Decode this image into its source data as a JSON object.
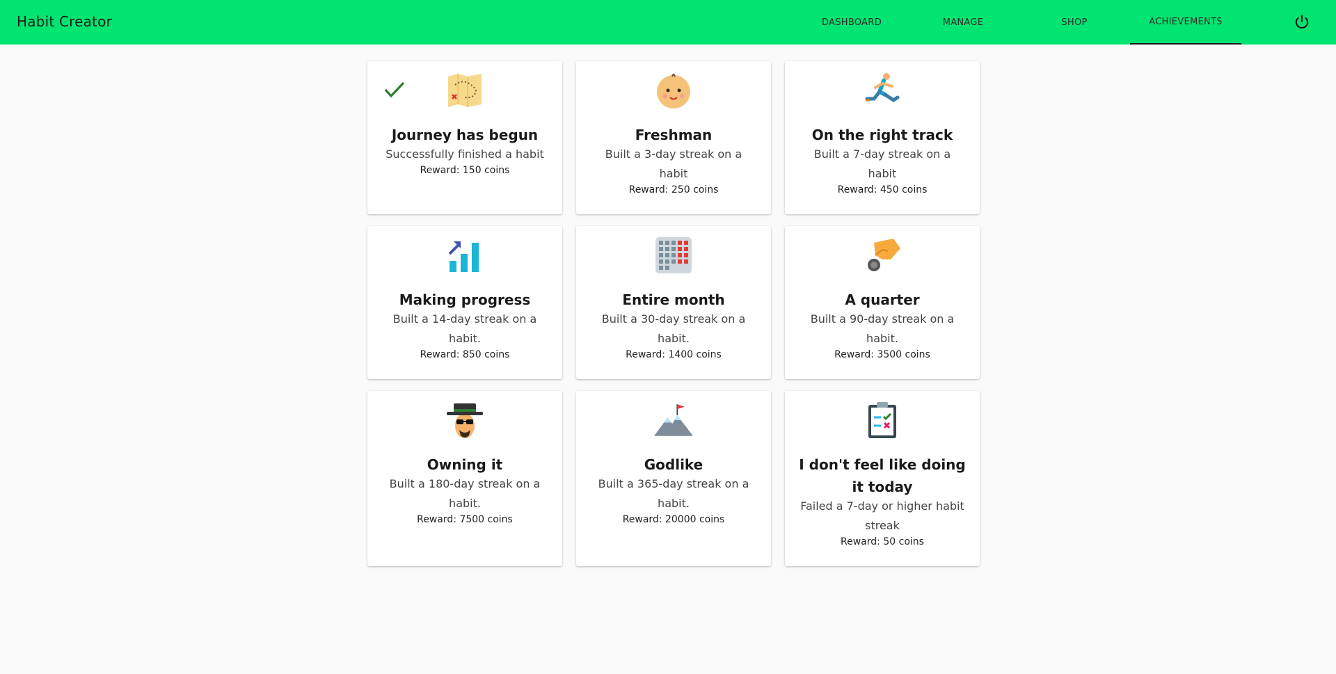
{
  "app": {
    "title": "Habit Creator"
  },
  "nav": {
    "tabs": [
      {
        "label": "DASHBOARD",
        "active": false
      },
      {
        "label": "MANAGE",
        "active": false
      },
      {
        "label": "SHOP",
        "active": false
      },
      {
        "label": "ACHIEVEMENTS",
        "active": true
      }
    ],
    "power_icon": "power-icon"
  },
  "colors": {
    "header": "#00e571",
    "background": "#fafafa",
    "check": "#2e7d32"
  },
  "achievements": [
    {
      "title": "Journey has begun",
      "description": "Successfully finished a habit",
      "reward": "Reward: 150 coins",
      "icon": "treasure-map-icon",
      "unlocked": true
    },
    {
      "title": "Freshman",
      "description": "Built a 3-day streak on a habit",
      "reward": "Reward: 250 coins",
      "icon": "baby-face-icon",
      "unlocked": false
    },
    {
      "title": "On the right track",
      "description": "Built a 7-day streak on a habit",
      "reward": "Reward: 450 coins",
      "icon": "runner-icon",
      "unlocked": false
    },
    {
      "title": "Making progress",
      "description": "Built a 14-day streak on a habit.",
      "reward": "Reward: 850 coins",
      "icon": "growth-chart-icon",
      "unlocked": false
    },
    {
      "title": "Entire month",
      "description": "Built a 30-day streak on a habit.",
      "reward": "Reward: 1400 coins",
      "icon": "calendar-grid-icon",
      "unlocked": false
    },
    {
      "title": "A quarter",
      "description": "Built a 90-day streak on a habit.",
      "reward": "Reward: 3500 coins",
      "icon": "hand-coin-icon",
      "unlocked": false
    },
    {
      "title": "Owning it",
      "description": "Built a 180-day streak on a habit.",
      "reward": "Reward: 7500 coins",
      "icon": "hat-sunglasses-man-icon",
      "unlocked": false
    },
    {
      "title": "Godlike",
      "description": "Built a 365-day streak on a habit.",
      "reward": "Reward: 20000 coins",
      "icon": "mountain-flag-icon",
      "unlocked": false
    },
    {
      "title": "I don't feel like doing it today",
      "description": "Failed a 7-day or higher habit streak",
      "reward": "Reward: 50 coins",
      "icon": "clipboard-checklist-icon",
      "unlocked": false
    }
  ]
}
